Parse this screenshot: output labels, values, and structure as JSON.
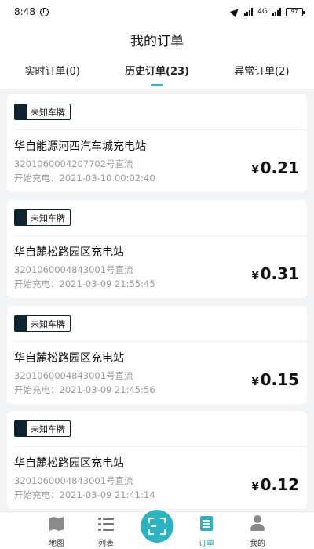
{
  "status_bar": {
    "time": "8:48",
    "network_right": "4G",
    "battery": "97"
  },
  "header": {
    "title": "我的订单"
  },
  "tabs": [
    {
      "label": "实时订单(0)",
      "active": false
    },
    {
      "label": "历史订单(23)",
      "active": true
    },
    {
      "label": "异常订单(2)",
      "active": false
    }
  ],
  "orders": [
    {
      "plate": "未知车牌",
      "station": "华自能源河西汽车城充电站",
      "pile": "3201060004207702号直流",
      "start_time": "开始充电：2021-03-10 00:02:40",
      "currency": "¥",
      "amount": "0.21"
    },
    {
      "plate": "未知车牌",
      "station": "华自麓松路园区充电站",
      "pile": "3201060004843001号直流",
      "start_time": "开始充电：2021-03-09 21:55:45",
      "currency": "¥",
      "amount": "0.31"
    },
    {
      "plate": "未知车牌",
      "station": "华自麓松路园区充电站",
      "pile": "3201060004843001号直流",
      "start_time": "开始充电：2021-03-09 21:45:56",
      "currency": "¥",
      "amount": "0.15"
    },
    {
      "plate": "未知车牌",
      "station": "华自麓松路园区充电站",
      "pile": "3201060004843001号直流",
      "start_time": "开始充电：2021-03-09 21:41:14",
      "currency": "¥",
      "amount": "0.12"
    }
  ],
  "bottom_nav": {
    "items": [
      {
        "label": "地图",
        "icon": "map-icon",
        "active": false
      },
      {
        "label": "列表",
        "icon": "list-icon",
        "active": false
      },
      {
        "label": "订单",
        "icon": "orders-icon",
        "active": true
      },
      {
        "label": "我的",
        "icon": "person-icon",
        "active": false
      }
    ],
    "scan_icon": "scan-icon"
  },
  "colors": {
    "accent": "#2bb3c0",
    "plate_dark": "#0e2530",
    "background": "#f2f3f5"
  }
}
